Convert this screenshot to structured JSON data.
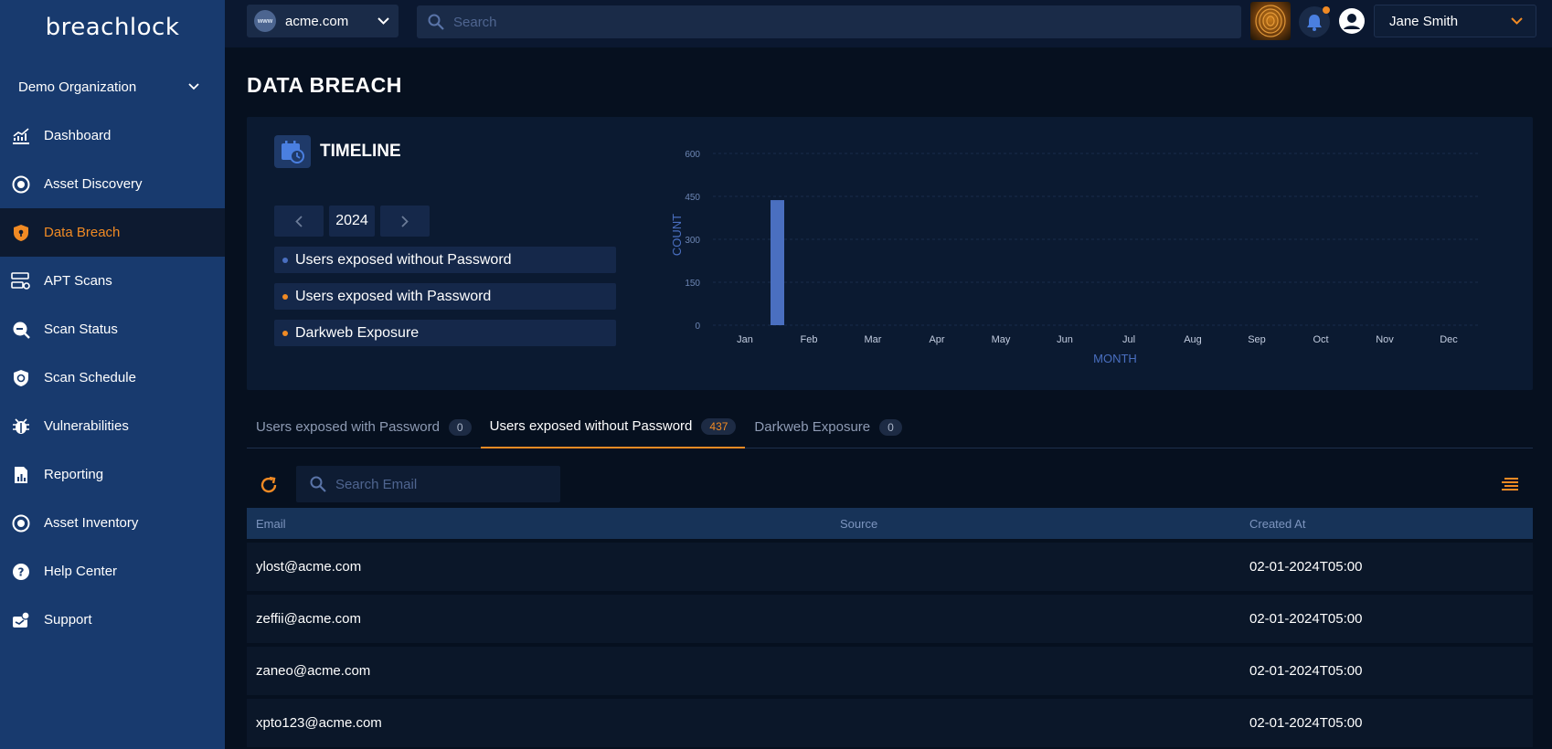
{
  "brand": {
    "logo_text": "breachlock"
  },
  "sidebar": {
    "org": "Demo Organization",
    "items": [
      {
        "label": "Dashboard",
        "icon": "chart-line-icon",
        "active": false
      },
      {
        "label": "Asset Discovery",
        "icon": "radar-icon",
        "active": false
      },
      {
        "label": "Data Breach",
        "icon": "shield-icon",
        "active": true
      },
      {
        "label": "APT Scans",
        "icon": "server-icon",
        "active": false
      },
      {
        "label": "Scan Status",
        "icon": "search-status-icon",
        "active": false
      },
      {
        "label": "Scan Schedule",
        "icon": "shield-clock-icon",
        "active": false
      },
      {
        "label": "Vulnerabilities",
        "icon": "bug-icon",
        "active": false
      },
      {
        "label": "Reporting",
        "icon": "report-icon",
        "active": false
      },
      {
        "label": "Asset Inventory",
        "icon": "inventory-icon",
        "active": false
      },
      {
        "label": "Help Center",
        "icon": "help-icon",
        "active": false
      },
      {
        "label": "Support",
        "icon": "support-icon",
        "active": false
      }
    ]
  },
  "topbar": {
    "domain_badge": "www",
    "domain": "acme.com",
    "search_placeholder": "Search",
    "user_name": "Jane Smith"
  },
  "page": {
    "title": "DATA BREACH"
  },
  "timeline": {
    "title": "TIMELINE",
    "year": "2024",
    "legend": [
      {
        "label": "Users exposed without Password",
        "color": "#4a6fc0"
      },
      {
        "label": "Users exposed with Password",
        "color": "#f08a24"
      },
      {
        "label": "Darkweb Exposure",
        "color": "#f08a24"
      }
    ]
  },
  "chart_data": {
    "type": "bar",
    "categories": [
      "Jan",
      "Feb",
      "Mar",
      "Apr",
      "May",
      "Jun",
      "Jul",
      "Aug",
      "Sep",
      "Oct",
      "Nov",
      "Dec"
    ],
    "series": [
      {
        "name": "Users exposed without Password",
        "values": [
          0,
          437,
          0,
          0,
          0,
          0,
          0,
          0,
          0,
          0,
          0,
          0
        ],
        "color": "#4a6fc0"
      }
    ],
    "yticks": [
      0,
      150,
      300,
      450,
      600
    ],
    "ylim": [
      0,
      600
    ],
    "xlabel": "MONTH",
    "ylabel": "COUNT"
  },
  "tabs": [
    {
      "label": "Users exposed with Password",
      "count": "0",
      "active": false
    },
    {
      "label": "Users exposed without Password",
      "count": "437",
      "active": true
    },
    {
      "label": "Darkweb Exposure",
      "count": "0",
      "active": false
    }
  ],
  "table": {
    "search_placeholder": "Search Email",
    "columns": [
      "Email",
      "Source",
      "Created At"
    ],
    "rows": [
      {
        "email": "ylost@acme.com",
        "source": "",
        "created": "02-01-2024T05:00"
      },
      {
        "email": "zeffii@acme.com",
        "source": "",
        "created": "02-01-2024T05:00"
      },
      {
        "email": "zaneo@acme.com",
        "source": "",
        "created": "02-01-2024T05:00"
      },
      {
        "email": "xpto123@acme.com",
        "source": "",
        "created": "02-01-2024T05:00"
      }
    ]
  }
}
